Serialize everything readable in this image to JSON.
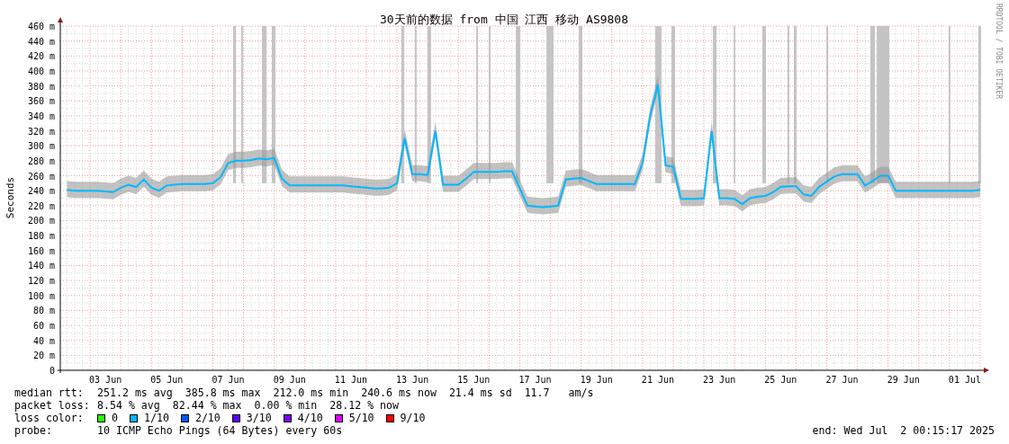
{
  "graph": {
    "watermark": "RRDTOOL / TOBI OETIKER",
    "chart_data": {
      "type": "line",
      "grid": true,
      "title": "30天前的数据 from 中国 江西 移动 AS9808",
      "ylabel": "Seconds",
      "ylim": [
        0,
        460
      ],
      "categories": [
        null,
        null,
        null,
        null,
        null,
        "03 Jun",
        null,
        null,
        null,
        null,
        null,
        null,
        null,
        "05 Jun",
        null,
        null,
        null,
        null,
        null,
        null,
        null,
        "07 Jun",
        null,
        null,
        null,
        null,
        null,
        null,
        null,
        "09 Jun",
        null,
        null,
        null,
        null,
        null,
        null,
        null,
        "11 Jun",
        null,
        null,
        null,
        null,
        null,
        null,
        null,
        "13 Jun",
        null,
        null,
        null,
        null,
        null,
        null,
        null,
        "15 Jun",
        null,
        null,
        null,
        null,
        null,
        null,
        null,
        "17 Jun",
        null,
        null,
        null,
        null,
        null,
        null,
        null,
        "19 Jun",
        null,
        null,
        null,
        null,
        null,
        null,
        null,
        "21 Jun",
        null,
        null,
        null,
        null,
        null,
        null,
        null,
        "23 Jun",
        null,
        null,
        null,
        null,
        null,
        null,
        null,
        "25 Jun",
        null,
        null,
        null,
        null,
        null,
        null,
        null,
        "27 Jun",
        null,
        null,
        null,
        null,
        null,
        null,
        null,
        "29 Jun",
        null,
        null,
        null,
        null,
        null,
        null,
        null,
        "01 Jul",
        null,
        null
      ],
      "yticks": [
        {
          "value": 0,
          "label": "0"
        },
        {
          "value": 20,
          "label": "20 m"
        },
        {
          "value": 40,
          "label": "40 m"
        },
        {
          "value": 60,
          "label": "60 m"
        },
        {
          "value": 80,
          "label": "80 m"
        },
        {
          "value": 100,
          "label": "100 m"
        },
        {
          "value": 120,
          "label": "120 m"
        },
        {
          "value": 140,
          "label": "140 m"
        },
        {
          "value": 160,
          "label": "160 m"
        },
        {
          "value": 180,
          "label": "180 m"
        },
        {
          "value": 200,
          "label": "200 m"
        },
        {
          "value": 220,
          "label": "220 m"
        },
        {
          "value": 240,
          "label": "240 m"
        },
        {
          "value": 260,
          "label": "260 m"
        },
        {
          "value": 280,
          "label": "280 m"
        },
        {
          "value": 300,
          "label": "300 m"
        },
        {
          "value": 320,
          "label": "320 m"
        },
        {
          "value": 340,
          "label": "340 m"
        },
        {
          "value": 360,
          "label": "360 m"
        },
        {
          "value": 380,
          "label": "380 m"
        },
        {
          "value": 400,
          "label": "400 m"
        },
        {
          "value": 420,
          "label": "420 m"
        },
        {
          "value": 440,
          "label": "440 m"
        },
        {
          "value": 460,
          "label": "460 m"
        }
      ],
      "series": [
        {
          "name": "median rtt:",
          "color": "#00b8ff",
          "values": [
            241,
            240,
            240,
            240,
            240,
            239,
            238,
            244,
            248,
            245,
            255,
            244,
            240,
            247,
            248,
            249,
            249,
            249,
            249,
            250,
            258,
            277,
            280,
            280,
            281,
            283,
            282,
            284,
            256,
            247,
            247,
            247,
            247,
            247,
            247,
            247,
            247,
            246,
            245,
            244,
            243,
            243,
            244,
            250,
            310,
            262,
            262,
            261,
            320,
            248,
            248,
            248,
            256,
            265,
            265,
            265,
            265,
            266,
            266,
            243,
            220,
            219,
            218,
            219,
            220,
            255,
            256,
            257,
            253,
            249,
            249,
            249,
            249,
            249,
            249,
            277,
            340,
            382,
            274,
            272,
            229,
            229,
            229,
            230,
            320,
            230,
            230,
            229,
            222,
            230,
            232,
            233,
            238,
            245,
            246,
            246,
            235,
            233,
            245,
            252,
            259,
            262,
            262,
            262,
            247,
            253,
            260,
            260,
            240,
            240,
            240,
            240,
            240,
            240,
            240,
            240,
            240,
            240,
            240,
            241
          ]
        }
      ]
    }
  },
  "legend": {
    "stats": [
      {
        "text": "251.2 ms avg  385.8 ms max  212.0 ms min  240.6 ms now  21.4 ms sd  11.7   am/s"
      },
      {
        "label": "packet loss:",
        "text": "8.54 % avg  82.44 % max  0.00 % min  28.12 % now"
      }
    ],
    "loss_color": {
      "label": "loss color:",
      "items": [
        {
          "label": "0",
          "color": "#26ff00"
        },
        {
          "label": "1/10",
          "color": "#00b8ff"
        },
        {
          "label": "2/10",
          "color": "#0059ff"
        },
        {
          "label": "3/10",
          "color": "#5e00ff"
        },
        {
          "label": "4/10",
          "color": "#7e00ff"
        },
        {
          "label": "5/10",
          "color": "#dd00ff"
        },
        {
          "label": "9/10",
          "color": "#ff0000"
        }
      ]
    },
    "probe": {
      "label": "probe:",
      "text": "10 ICMP Echo Pings (64 Bytes) every 60s"
    },
    "end": "end: Wed Jul  2 00:15:17 2025"
  }
}
